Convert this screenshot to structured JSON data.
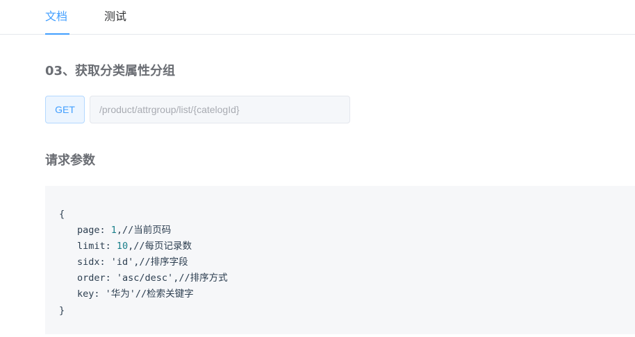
{
  "tabs": [
    {
      "label": "文档",
      "active": true
    },
    {
      "label": "测试",
      "active": false
    }
  ],
  "api": {
    "title": "03、获取分类属性分组",
    "method": "GET",
    "url": "/product/attrgroup/list/{catelogId}"
  },
  "params": {
    "title": "请求参数",
    "open_brace": "{",
    "close_brace": "}",
    "lines": [
      {
        "key": "page: ",
        "value": "1",
        "rest": ",//当前页码"
      },
      {
        "key": "limit: ",
        "value": "10",
        "rest": ",//每页记录数"
      },
      {
        "key": "sidx: ",
        "value": "'id'",
        "rest": ",//排序字段"
      },
      {
        "key": "order: ",
        "value": "'asc/desc'",
        "rest": ",//排序方式"
      },
      {
        "key": "key: ",
        "value": "'华为'",
        "rest": "//检索关键字"
      }
    ]
  },
  "colors": {
    "accent": "#409eff",
    "number": "#1a7f8a",
    "code_bg": "#f6f7f9"
  }
}
